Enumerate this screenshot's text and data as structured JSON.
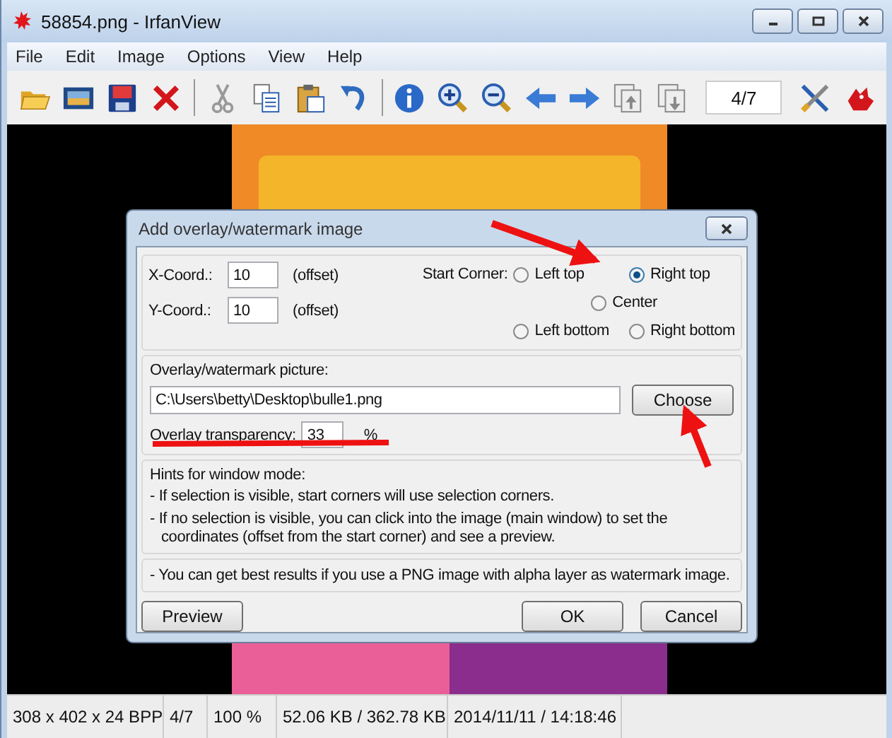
{
  "window": {
    "title": "58854.png - IrfanView"
  },
  "menu": [
    "File",
    "Edit",
    "Image",
    "Options",
    "View",
    "Help"
  ],
  "toolbar": {
    "page_field": "4/7"
  },
  "dialog": {
    "title": "Add overlay/watermark image",
    "x_coord": {
      "label": "X-Coord.:",
      "value": "10",
      "suffix": "(offset)"
    },
    "y_coord": {
      "label": "Y-Coord.:",
      "value": "10",
      "suffix": "(offset)"
    },
    "start_corner": {
      "label": "Start Corner:",
      "options": [
        {
          "label": "Left top",
          "selected": false
        },
        {
          "label": "Right top",
          "selected": true
        },
        {
          "label": "Center",
          "selected": false
        },
        {
          "label": "Left bottom",
          "selected": false
        },
        {
          "label": "Right bottom",
          "selected": false
        }
      ]
    },
    "picture": {
      "label": "Overlay/watermark picture:",
      "value": "C:\\Users\\betty\\Desktop\\bulle1.png",
      "button": "Choose"
    },
    "transparency": {
      "label": "Overlay transparency:",
      "value": "33",
      "unit": "%"
    },
    "hints": {
      "title": "Hints for window mode:",
      "lines": [
        "- If selection is visible, start corners will use selection corners.",
        "- If no selection is visible, you can click into the image (main window) to set the coordinates (offset from the start corner) and see a preview."
      ]
    },
    "note": "- You can get best results if you use a PNG image with alpha layer as watermark image.",
    "buttons": [
      "Preview",
      "OK",
      "Cancel"
    ]
  },
  "status_bar": [
    "308 x 402 x 24 BPP",
    "4/7",
    "100 %",
    "52.06 KB / 362.78 KB",
    "2014/11/11 / 14:18:46"
  ]
}
